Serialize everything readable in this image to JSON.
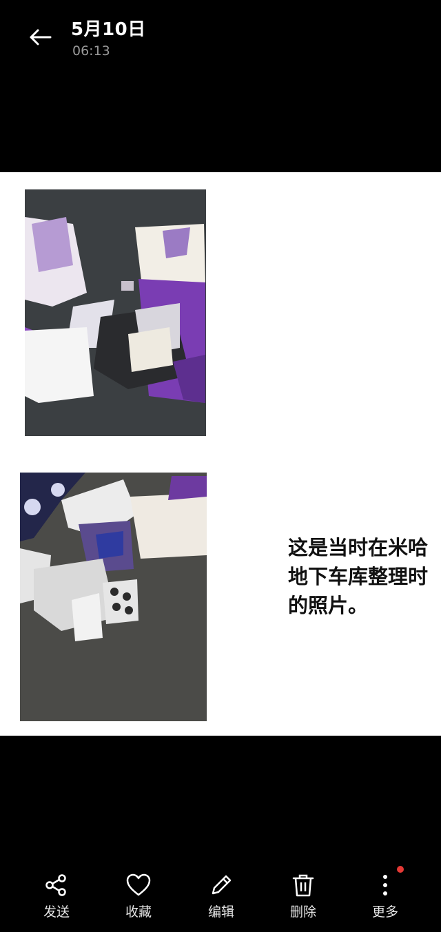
{
  "header": {
    "title": "5月10日",
    "time": "06:13"
  },
  "content": {
    "caption_lines": [
      "这是当时在米哈",
      "地下车库整理时",
      "的照片。"
    ]
  },
  "toolbar": {
    "items": [
      {
        "label": "发送",
        "icon": "share-icon"
      },
      {
        "label": "收藏",
        "icon": "heart-icon"
      },
      {
        "label": "编辑",
        "icon": "pencil-icon"
      },
      {
        "label": "删除",
        "icon": "trash-icon"
      },
      {
        "label": "更多",
        "icon": "more-vertical-icon"
      }
    ],
    "notification_dot_color": "#e53935"
  },
  "colors": {
    "background": "#000000",
    "photo_background": "#ffffff",
    "accent_purple": "#7b3fb0"
  }
}
